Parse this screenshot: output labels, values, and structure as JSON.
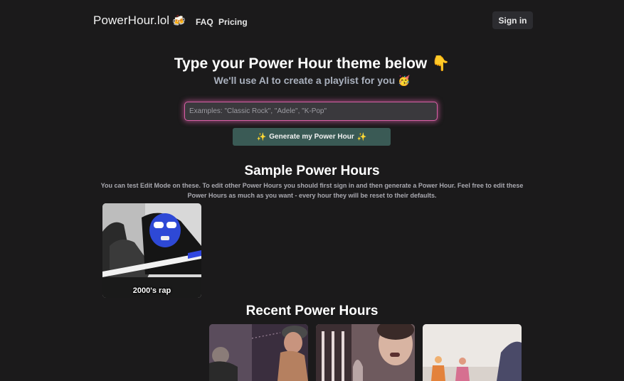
{
  "nav": {
    "brand": "PowerHour.lol",
    "brand_emoji": "🍻",
    "links": [
      "FAQ",
      "Pricing"
    ],
    "signin": "Sign in"
  },
  "hero": {
    "title": "Type your Power Hour theme below",
    "title_emoji": "👇",
    "subtitle": "We'll use AI to create a playlist for you",
    "subtitle_emoji": "🥳",
    "input_placeholder": "Examples: \"Classic Rock\", \"Adele\", \"K-Pop\"",
    "input_value": "",
    "generate_label": "Generate my Power Hour"
  },
  "samples": {
    "title": "Sample Power Hours",
    "description": "You can test Edit Mode on these. To edit other Power Hours you should first sign in and then generate a Power Hour. Feel free to edit these Power Hours as much as you want - every hour they will be reset to their defaults.",
    "items": [
      {
        "label": "2000's rap"
      }
    ]
  },
  "recent": {
    "title": "Recent Power Hours"
  },
  "colors": {
    "background": "#1b1a1b",
    "input_glow": "#d95fa6",
    "generate_button": "#3a5a55"
  }
}
